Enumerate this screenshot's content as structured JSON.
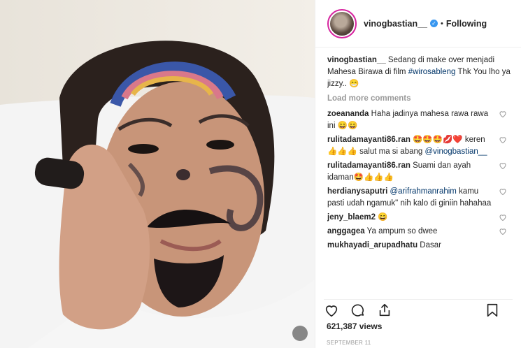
{
  "post": {
    "username": "vinogbastian__",
    "dot": "•",
    "follow_label": "Following",
    "verified_icon": "verified-badge-icon"
  },
  "caption": {
    "username": "vinogbastian__",
    "text": " Sedang di make over menjadi Mahesa Birawa di film ",
    "hashtag": "#wirosableng",
    "text_after": " Thk You lho ya jizzy.. 😁"
  },
  "load_more": "Load more comments",
  "comments": [
    {
      "username": "zoeananda",
      "text": " Haha jadinya mahesa rawa rawa ini 😄😄"
    },
    {
      "username": "rulitadamayanti86.ran",
      "text": " 🤩🤩🤩💋❤️ keren👍👍👍 salut ma si abang ",
      "mention": "@vinogbastian__"
    },
    {
      "username": "rulitadamayanti86.ran",
      "text": " Suami dan ayah idaman🤩👍👍👍"
    },
    {
      "username": "herdianysaputri",
      "text": " ",
      "mention": "@arifrahmanrahim",
      "text_after": " kamu pasti udah ngamuk\" nih kalo di giniin hahahaa"
    },
    {
      "username": "jeny_blaem2",
      "text": " 😄"
    },
    {
      "username": "anggagea",
      "text": " Ya ampum so dwee"
    },
    {
      "username": "mukhayadi_arupadhatu",
      "text": " Dasar"
    }
  ],
  "stats": {
    "views": "621,387 views",
    "date": "SEPTEMBER 11"
  },
  "colors": {
    "accent": "#3897f0",
    "link": "#003569",
    "muted": "#999999"
  }
}
